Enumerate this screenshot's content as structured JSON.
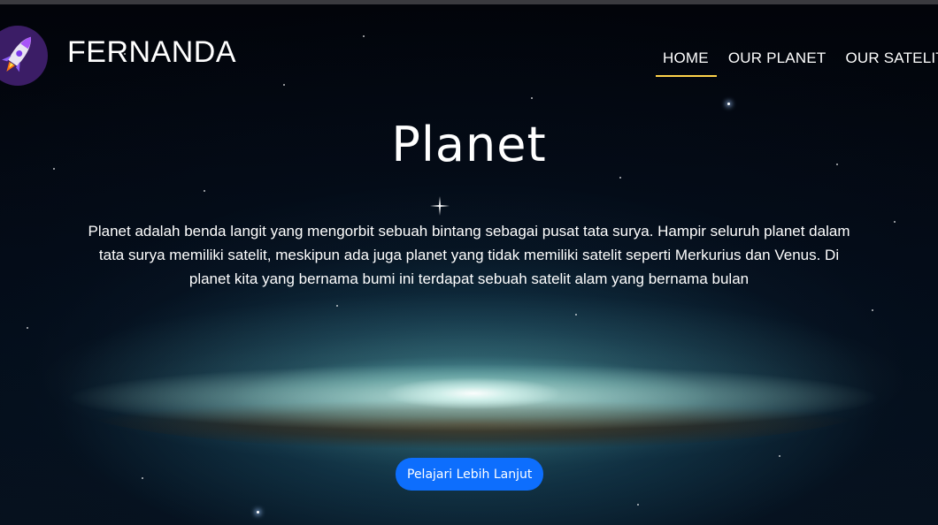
{
  "header": {
    "brand_name": "FERNANDA",
    "logo_icon": "rocket-icon"
  },
  "nav": {
    "items": [
      {
        "label": "HOME",
        "active": true
      },
      {
        "label": "OUR PLANET",
        "active": false
      },
      {
        "label": "OUR SATELIT",
        "active": false
      }
    ]
  },
  "hero": {
    "title": "Planet",
    "description": "Planet adalah benda langit yang mengorbit sebuah bintang sebagai pusat tata surya. Hampir seluruh planet dalam tata surya memiliki satelit, meskipun ada juga planet yang tidak memiliki satelit seperti Merkurius dan Venus. Di planet kita yang bernama bumi ini terdapat sebuah satelit alam yang bernama bulan",
    "cta_label": "Pelajari Lebih Lanjut"
  },
  "colors": {
    "accent_underline": "#ffd24a",
    "button_bg": "#0d6efd",
    "text": "#ffffff"
  }
}
